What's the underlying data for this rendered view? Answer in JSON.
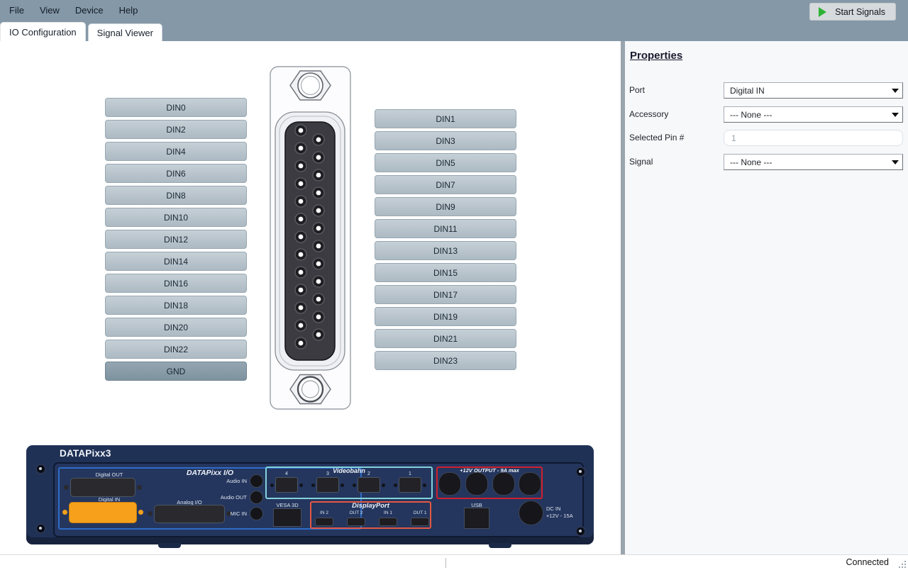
{
  "menu": {
    "items": [
      "File",
      "View",
      "Device",
      "Help"
    ]
  },
  "toolbar": {
    "start_signals": "Start Signals",
    "play_color": "#2eb335"
  },
  "tabs": [
    {
      "label": "IO Configuration",
      "active": true
    },
    {
      "label": "Signal Viewer",
      "active": false
    }
  ],
  "pin_map": {
    "left_pins": [
      "DIN0",
      "DIN2",
      "DIN4",
      "DIN6",
      "DIN8",
      "DIN10",
      "DIN12",
      "DIN14",
      "DIN16",
      "DIN18",
      "DIN20",
      "DIN22",
      "GND"
    ],
    "right_pins": [
      "DIN1",
      "DIN3",
      "DIN5",
      "DIN7",
      "DIN9",
      "DIN11",
      "DIN13",
      "DIN15",
      "DIN17",
      "DIN19",
      "DIN21",
      "DIN23"
    ],
    "connector_pin_count": 25
  },
  "properties": {
    "title": "Properties",
    "fields": [
      {
        "label": "Port",
        "type": "select",
        "value": "Digital IN"
      },
      {
        "label": "Accessory",
        "type": "select",
        "value": "--- None ---"
      },
      {
        "label": "Selected Pin #",
        "type": "input",
        "value": "1"
      },
      {
        "label": "Signal",
        "type": "select",
        "value": "--- None ---"
      }
    ]
  },
  "device": {
    "title": "DATAPixx3",
    "io_section": "DATAPixx I/O",
    "digital_out": "Digital OUT",
    "digital_in": "Digital IN",
    "analog_io": "Analog I/O",
    "audio_in": "Audio IN",
    "audio_out": "Audio OUT",
    "mic_in": "MIC IN",
    "videobahn": "Videobahn",
    "videobahn_ports": [
      "4",
      "3",
      "2",
      "1"
    ],
    "vesa": "VESA 3D",
    "displayport": "DisplayPort",
    "dp_ports": [
      "IN 2",
      "OUT 2",
      "IN 1",
      "OUT 1"
    ],
    "usb": "USB",
    "pwr_out": "+12V OUTPUT - 9A max",
    "dc_in_line1": "DC IN",
    "dc_in_line2": "+12V - 15A",
    "highlight_color": "#f7a01b",
    "io_border": "#2e6cc8",
    "videobahn_border": "#82d2da",
    "displayport_border": "#e25844",
    "pwr_border": "#d01f2e"
  },
  "status": {
    "connected": "Connected"
  }
}
